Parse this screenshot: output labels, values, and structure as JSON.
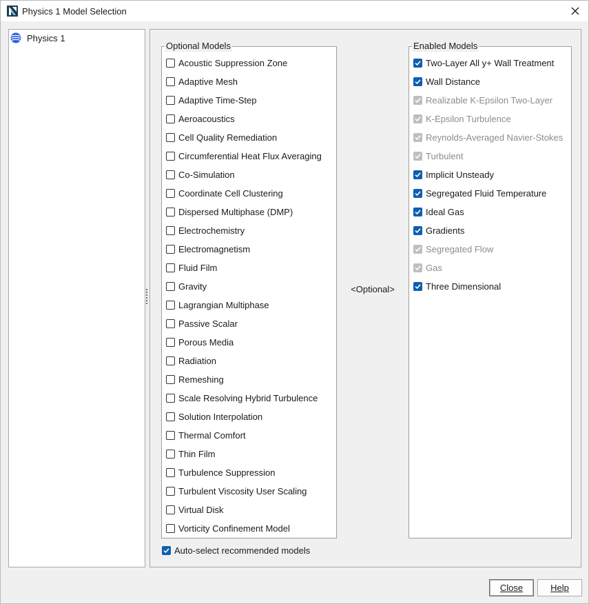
{
  "window": {
    "title": "Physics 1 Model Selection",
    "app_icon": "simcenter-app-icon",
    "close_icon": "close-icon"
  },
  "tree": {
    "items": [
      {
        "label": "Physics 1",
        "icon": "globe-icon",
        "icon_color": "#2d5fe0"
      }
    ]
  },
  "optional_models": {
    "title": "Optional Models",
    "items": [
      {
        "label": "Acoustic Suppression Zone",
        "checked": false
      },
      {
        "label": "Adaptive Mesh",
        "checked": false
      },
      {
        "label": "Adaptive Time-Step",
        "checked": false
      },
      {
        "label": "Aeroacoustics",
        "checked": false
      },
      {
        "label": "Cell Quality Remediation",
        "checked": false
      },
      {
        "label": "Circumferential Heat Flux Averaging",
        "checked": false
      },
      {
        "label": "Co-Simulation",
        "checked": false
      },
      {
        "label": "Coordinate Cell Clustering",
        "checked": false
      },
      {
        "label": "Dispersed Multiphase (DMP)",
        "checked": false
      },
      {
        "label": "Electrochemistry",
        "checked": false
      },
      {
        "label": "Electromagnetism",
        "checked": false
      },
      {
        "label": "Fluid Film",
        "checked": false
      },
      {
        "label": "Gravity",
        "checked": false
      },
      {
        "label": "Lagrangian Multiphase",
        "checked": false
      },
      {
        "label": "Passive Scalar",
        "checked": false
      },
      {
        "label": "Porous Media",
        "checked": false
      },
      {
        "label": "Radiation",
        "checked": false
      },
      {
        "label": "Remeshing",
        "checked": false
      },
      {
        "label": "Scale Resolving Hybrid Turbulence",
        "checked": false
      },
      {
        "label": "Solution Interpolation",
        "checked": false
      },
      {
        "label": "Thermal Comfort",
        "checked": false
      },
      {
        "label": "Thin Film",
        "checked": false
      },
      {
        "label": "Turbulence Suppression",
        "checked": false
      },
      {
        "label": "Turbulent Viscosity User Scaling",
        "checked": false
      },
      {
        "label": "Virtual Disk",
        "checked": false
      },
      {
        "label": "Vorticity Confinement Model",
        "checked": false
      }
    ]
  },
  "middle": {
    "label": "<Optional>"
  },
  "enabled_models": {
    "title": "Enabled Models",
    "items": [
      {
        "label": "Two-Layer All y+ Wall Treatment",
        "checked": true,
        "disabled": false
      },
      {
        "label": "Wall Distance",
        "checked": true,
        "disabled": false
      },
      {
        "label": "Realizable K-Epsilon Two-Layer",
        "checked": true,
        "disabled": true
      },
      {
        "label": "K-Epsilon Turbulence",
        "checked": true,
        "disabled": true
      },
      {
        "label": "Reynolds-Averaged Navier-Stokes",
        "checked": true,
        "disabled": true
      },
      {
        "label": "Turbulent",
        "checked": true,
        "disabled": true
      },
      {
        "label": "Implicit Unsteady",
        "checked": true,
        "disabled": false
      },
      {
        "label": "Segregated Fluid Temperature",
        "checked": true,
        "disabled": false
      },
      {
        "label": "Ideal Gas",
        "checked": true,
        "disabled": false
      },
      {
        "label": "Gradients",
        "checked": true,
        "disabled": false
      },
      {
        "label": "Segregated Flow",
        "checked": true,
        "disabled": true
      },
      {
        "label": "Gas",
        "checked": true,
        "disabled": true
      },
      {
        "label": "Three Dimensional",
        "checked": true,
        "disabled": false
      }
    ]
  },
  "auto_select": {
    "label": "Auto-select recommended models",
    "checked": true
  },
  "buttons": {
    "close_label": "Close",
    "help_label": "Help"
  },
  "colors": {
    "check_accent": "#0f5eb0",
    "check_disabled": "#bfbfbf",
    "disabled_text": "#8c8c8c"
  }
}
